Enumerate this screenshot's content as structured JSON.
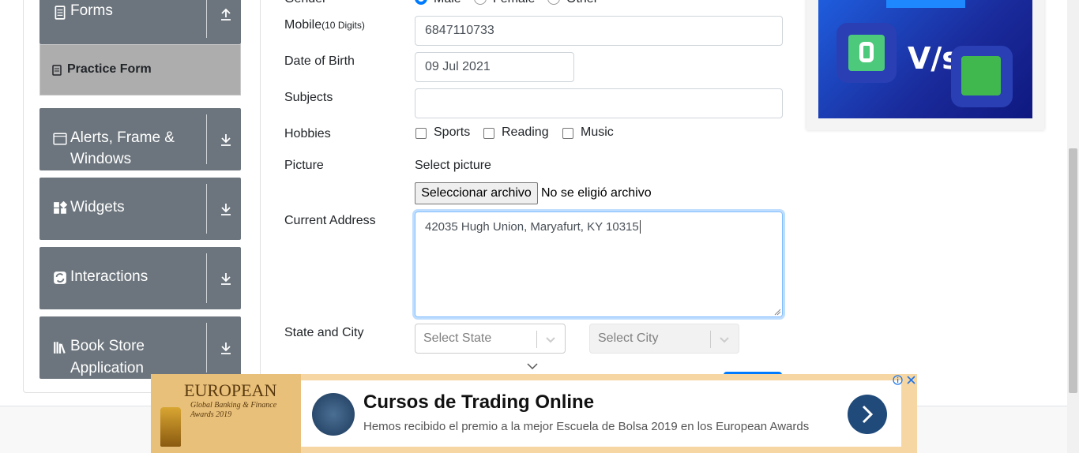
{
  "sidebar": {
    "forms": "Forms",
    "practice_form": "Practice Form",
    "alerts_line1": "Alerts, Frame &",
    "alerts_line2": "Windows",
    "widgets": "Widgets",
    "interactions": "Interactions",
    "bookstore_line1": "Book Store",
    "bookstore_line2": "Application"
  },
  "form": {
    "gender_label": "Gender",
    "gender_options": [
      "Male",
      "Female",
      "Other"
    ],
    "gender_selected": "Male",
    "mobile_label": "Mobile",
    "mobile_hint": "(10 Digits)",
    "mobile_value": "6847110733",
    "dob_label": "Date of Birth",
    "dob_value": "09 Jul 2021",
    "subjects_label": "Subjects",
    "subjects_value": "",
    "hobbies_label": "Hobbies",
    "hobbies": [
      "Sports",
      "Reading",
      "Music"
    ],
    "picture_label": "Picture",
    "picture_prompt": "Select picture",
    "file_button": "Seleccionar archivo",
    "file_status": "No se eligió archivo",
    "address_label": "Current Address",
    "address_value": "42035 Hugh Union, Maryafurt, KY 10315",
    "state_city_label": "State and City",
    "state_placeholder": "Select State",
    "city_placeholder": "Select City"
  },
  "side_ad": {
    "vs_text": "V/s"
  },
  "banner": {
    "award_title": "EUROPEAN",
    "award_sub": "Global Banking & Finance Awards 2019",
    "headline": "Cursos de Trading Online",
    "subtext": "Hemos recibido el premio a la mejor Escuela de Bolsa 2019 en los European Awards"
  },
  "colors": {
    "sidebar_group": "#6c757d",
    "active_item": "#adadad",
    "accent": "#007bff",
    "banner_bg": "#f6d7a3",
    "banner_button": "#1f4a7a"
  }
}
